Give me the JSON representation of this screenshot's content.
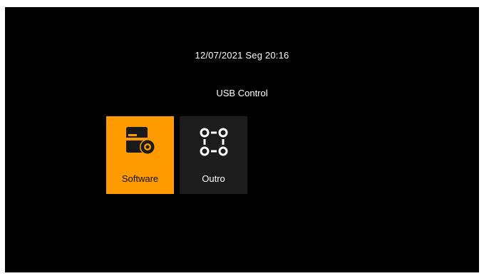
{
  "header": {
    "datetime": "12/07/2021 Seg 20:16",
    "menu_title": "USB Control"
  },
  "tiles": [
    {
      "label": "Software",
      "icon": "disk-drive-icon",
      "selected": true
    },
    {
      "label": "Outro",
      "icon": "nodes-grid-icon",
      "selected": false
    }
  ],
  "colors": {
    "background": "#000000",
    "selected_tile": "#ff9a00",
    "tile": "#1c1c1c",
    "text": "#ffffff"
  }
}
